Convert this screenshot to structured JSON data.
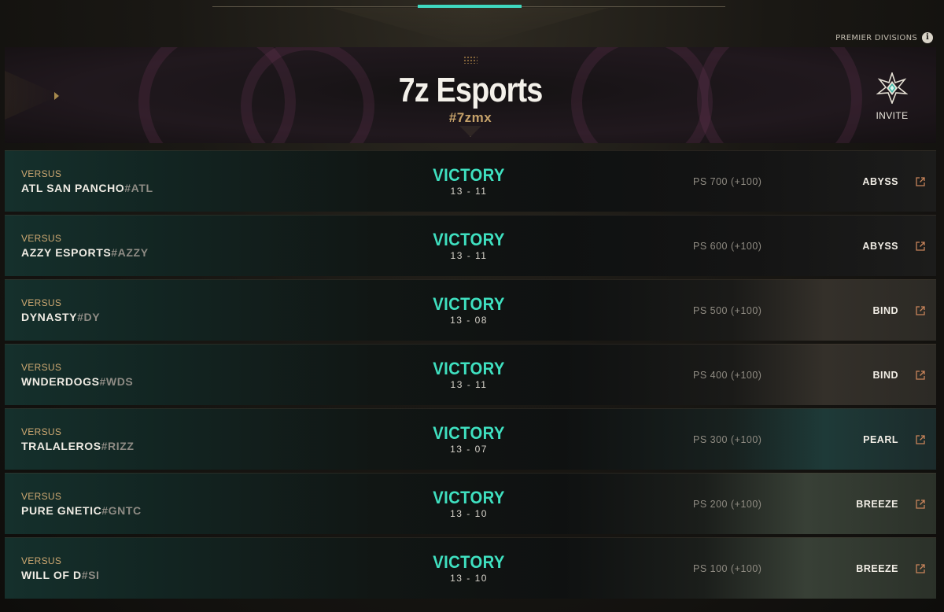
{
  "header": {
    "premier_label": "PREMIER DIVISIONS",
    "info_icon": "i"
  },
  "team": {
    "name": "7z Esports",
    "tag": "#7zmx",
    "invite_label": "INVITE"
  },
  "colors": {
    "accent": "#3fe0c0",
    "gold": "#cfa972"
  },
  "matches": [
    {
      "versus_label": "VERSUS",
      "opponent": "ATL SAN PANCHO",
      "opponent_tag": "#ATL",
      "result": "VICTORY",
      "score": "13 - 11",
      "ps": "PS 700 (+100)",
      "map": "ABYSS"
    },
    {
      "versus_label": "VERSUS",
      "opponent": "AZZY ESPORTS",
      "opponent_tag": "#AZZY",
      "result": "VICTORY",
      "score": "13 - 11",
      "ps": "PS 600 (+100)",
      "map": "ABYSS"
    },
    {
      "versus_label": "VERSUS",
      "opponent": "DYNASTY",
      "opponent_tag": "#DY",
      "result": "VICTORY",
      "score": "13 - 08",
      "ps": "PS 500 (+100)",
      "map": "BIND"
    },
    {
      "versus_label": "VERSUS",
      "opponent": "WNDERDOGS",
      "opponent_tag": "#WDS",
      "result": "VICTORY",
      "score": "13 - 11",
      "ps": "PS 400 (+100)",
      "map": "BIND"
    },
    {
      "versus_label": "VERSUS",
      "opponent": "TRALALEROS",
      "opponent_tag": "#RIZZ",
      "result": "VICTORY",
      "score": "13 - 07",
      "ps": "PS 300 (+100)",
      "map": "PEARL"
    },
    {
      "versus_label": "VERSUS",
      "opponent": "PURE GNETIC",
      "opponent_tag": "#GNTC",
      "result": "VICTORY",
      "score": "13 - 10",
      "ps": "PS 200 (+100)",
      "map": "BREEZE"
    },
    {
      "versus_label": "VERSUS",
      "opponent": "WILL OF D",
      "opponent_tag": "#SI",
      "result": "VICTORY",
      "score": "13 - 10",
      "ps": "PS 100 (+100)",
      "map": "BREEZE"
    }
  ]
}
